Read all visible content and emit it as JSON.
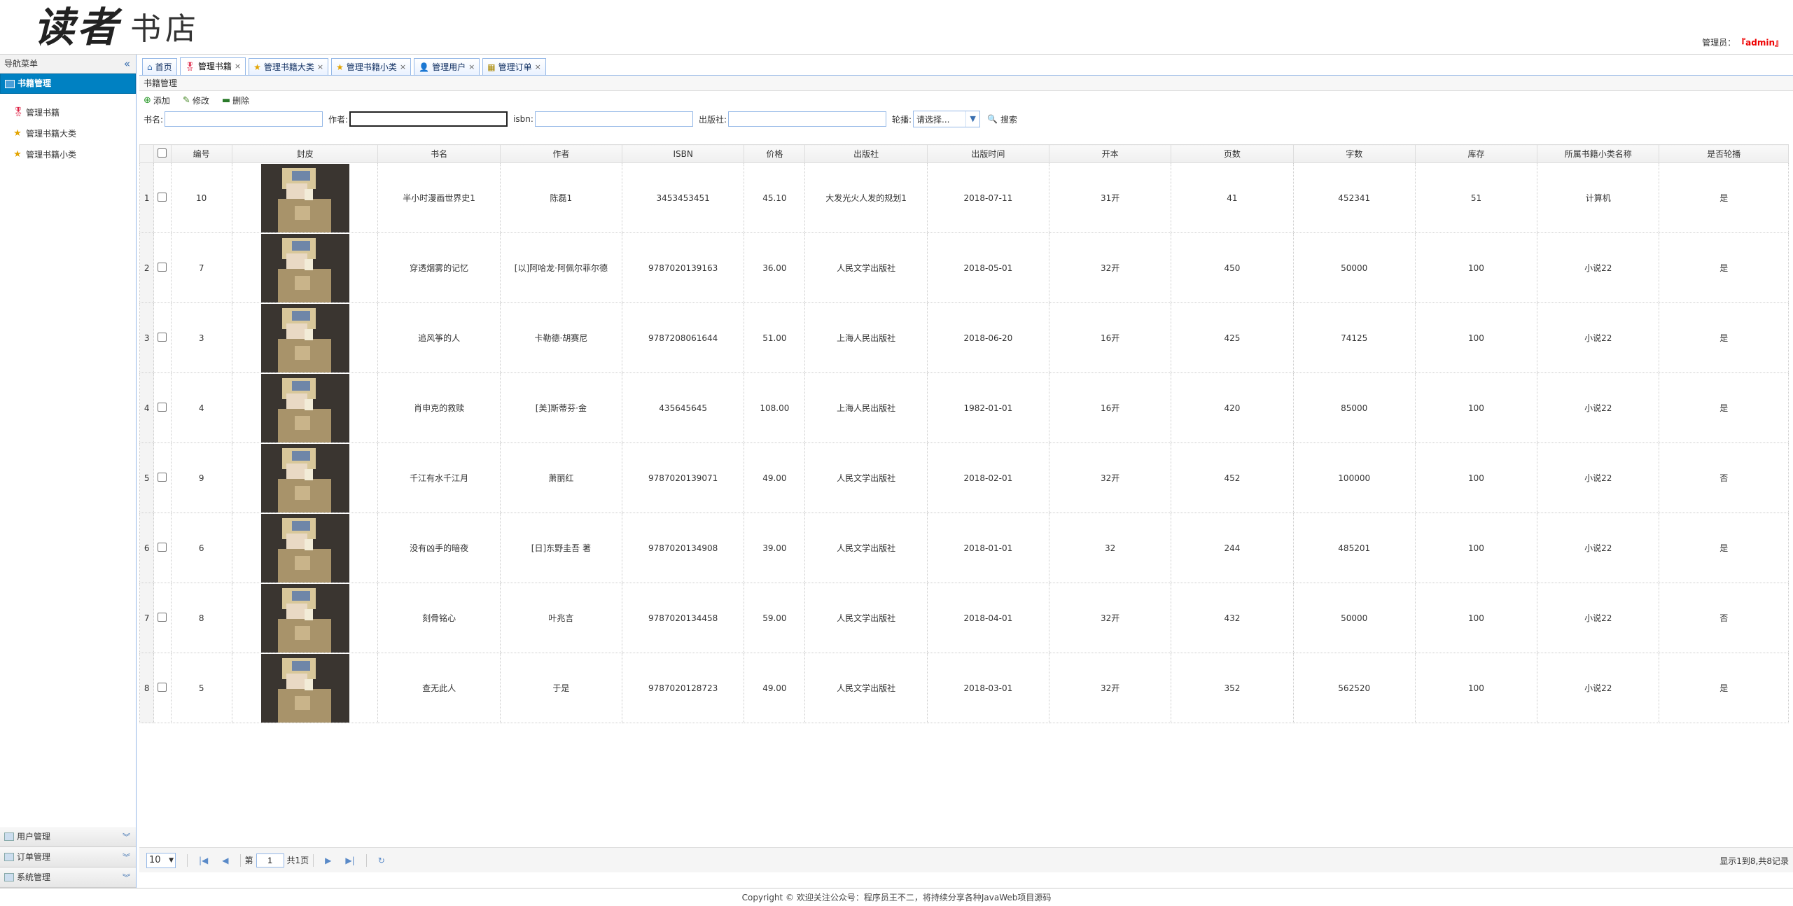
{
  "header": {
    "logo_script": "读者",
    "logo_sub": "书店",
    "user_label": "管理员：",
    "user_name": "『admin』"
  },
  "sidebar": {
    "title": "导航菜单",
    "collapse_glyph": "«",
    "active_section": "书籍管理",
    "items": [
      {
        "label": "管理书籍",
        "icon": "award-icon"
      },
      {
        "label": "管理书籍大类",
        "icon": "star-icon"
      },
      {
        "label": "管理书籍小类",
        "icon": "star-icon"
      }
    ],
    "bottom_sections": [
      "用户管理",
      "订单管理",
      "系统管理"
    ]
  },
  "tabs": [
    {
      "label": "首页",
      "icon": "home-icon",
      "closable": false
    },
    {
      "label": "管理书籍",
      "icon": "award-icon",
      "closable": true
    },
    {
      "label": "管理书籍大类",
      "icon": "star-icon",
      "closable": true
    },
    {
      "label": "管理书籍小类",
      "icon": "star-icon",
      "closable": true
    },
    {
      "label": "管理用户",
      "icon": "user-icon",
      "closable": true
    },
    {
      "label": "管理订单",
      "icon": "order-icon",
      "closable": true
    }
  ],
  "panel": {
    "title": "书籍管理"
  },
  "toolbar": {
    "add": "添加",
    "edit": "修改",
    "delete": "删除"
  },
  "search": {
    "book_label": "书名:",
    "author_label": "作者:",
    "isbn_label": "isbn:",
    "publisher_label": "出版社:",
    "carousel_label": "轮播:",
    "carousel_value": "请选择...",
    "search_btn": "搜索"
  },
  "grid": {
    "columns": [
      "编号",
      "封皮",
      "书名",
      "作者",
      "ISBN",
      "价格",
      "出版社",
      "出版时间",
      "开本",
      "页数",
      "字数",
      "库存",
      "所属书籍小类名称",
      "是否轮播"
    ],
    "rows": [
      {
        "rn": "1",
        "id": "10",
        "name": "半小时漫画世界史1",
        "author": "陈磊1",
        "isbn": "3453453451",
        "price": "45.10",
        "publisher": "大发光火人发的规划1",
        "date": "2018-07-11",
        "format": "31开",
        "pages": "41",
        "words": "452341",
        "stock": "51",
        "subcat": "计算机",
        "carousel": "是"
      },
      {
        "rn": "2",
        "id": "7",
        "name": "穿透烟雾的记忆",
        "author": "[以]阿哈龙·阿佩尔菲尔德",
        "isbn": "9787020139163",
        "price": "36.00",
        "publisher": "人民文学出版社",
        "date": "2018-05-01",
        "format": "32开",
        "pages": "450",
        "words": "50000",
        "stock": "100",
        "subcat": "小说22",
        "carousel": "是"
      },
      {
        "rn": "3",
        "id": "3",
        "name": "追风筝的人",
        "author": "卡勒德·胡赛尼",
        "isbn": "9787208061644",
        "price": "51.00",
        "publisher": "上海人民出版社",
        "date": "2018-06-20",
        "format": "16开",
        "pages": "425",
        "words": "74125",
        "stock": "100",
        "subcat": "小说22",
        "carousel": "是"
      },
      {
        "rn": "4",
        "id": "4",
        "name": "肖申克的救赎",
        "author": "[美]斯蒂芬·金",
        "isbn": "435645645",
        "price": "108.00",
        "publisher": "上海人民出版社",
        "date": "1982-01-01",
        "format": "16开",
        "pages": "420",
        "words": "85000",
        "stock": "100",
        "subcat": "小说22",
        "carousel": "是"
      },
      {
        "rn": "5",
        "id": "9",
        "name": "千江有水千江月",
        "author": "萧丽红",
        "isbn": "9787020139071",
        "price": "49.00",
        "publisher": "人民文学出版社",
        "date": "2018-02-01",
        "format": "32开",
        "pages": "452",
        "words": "100000",
        "stock": "100",
        "subcat": "小说22",
        "carousel": "否"
      },
      {
        "rn": "6",
        "id": "6",
        "name": "没有凶手的暗夜",
        "author": "[日]东野圭吾 著",
        "isbn": "9787020134908",
        "price": "39.00",
        "publisher": "人民文学出版社",
        "date": "2018-01-01",
        "format": "32",
        "pages": "244",
        "words": "485201",
        "stock": "100",
        "subcat": "小说22",
        "carousel": "是"
      },
      {
        "rn": "7",
        "id": "8",
        "name": "刻骨铭心",
        "author": "叶兆言",
        "isbn": "9787020134458",
        "price": "59.00",
        "publisher": "人民文学出版社",
        "date": "2018-04-01",
        "format": "32开",
        "pages": "432",
        "words": "50000",
        "stock": "100",
        "subcat": "小说22",
        "carousel": "否"
      },
      {
        "rn": "8",
        "id": "5",
        "name": "查无此人",
        "author": "于是",
        "isbn": "9787020128723",
        "price": "49.00",
        "publisher": "人民文学出版社",
        "date": "2018-03-01",
        "format": "32开",
        "pages": "352",
        "words": "562520",
        "stock": "100",
        "subcat": "小说22",
        "carousel": "是"
      }
    ]
  },
  "pager": {
    "page_size": "10",
    "page_prefix": "第",
    "current_page": "1",
    "page_suffix": "共1页",
    "info": "显示1到8,共8记录"
  },
  "footer": "Copyright © 欢迎关注公众号：程序员王不二，将持续分享各种JavaWeb项目源码"
}
